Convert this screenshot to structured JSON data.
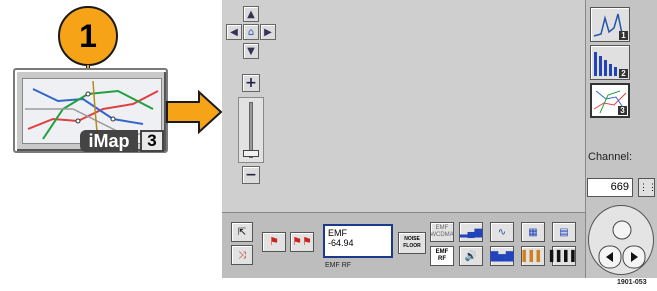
{
  "callout": {
    "number": "1"
  },
  "imap_button": {
    "label": "iMap",
    "number": "3"
  },
  "nav": {
    "up_icon": "arrow-up-icon",
    "down_icon": "arrow-down-icon",
    "left_icon": "arrow-left-icon",
    "right_icon": "arrow-right-icon",
    "home_icon": "home-icon"
  },
  "zoom": {
    "plus": "+",
    "minus": "−",
    "level": 0.12
  },
  "views": [
    {
      "icon": "spectrum-view-icon",
      "number": "1"
    },
    {
      "icon": "bar-view-icon",
      "number": "2"
    },
    {
      "icon": "map-view-icon",
      "number": "3"
    }
  ],
  "channel": {
    "label": "Channel:",
    "value": "669"
  },
  "toolbar": {
    "readout_title": "EMF",
    "readout_value": "-64.94",
    "readout_caption": "EMF RF",
    "noise_floor": "NOISE FLOOR",
    "emf_wcdma": "EMF WCDMA",
    "emf_rf": "EMF RF"
  },
  "figure_id": "1901-053"
}
